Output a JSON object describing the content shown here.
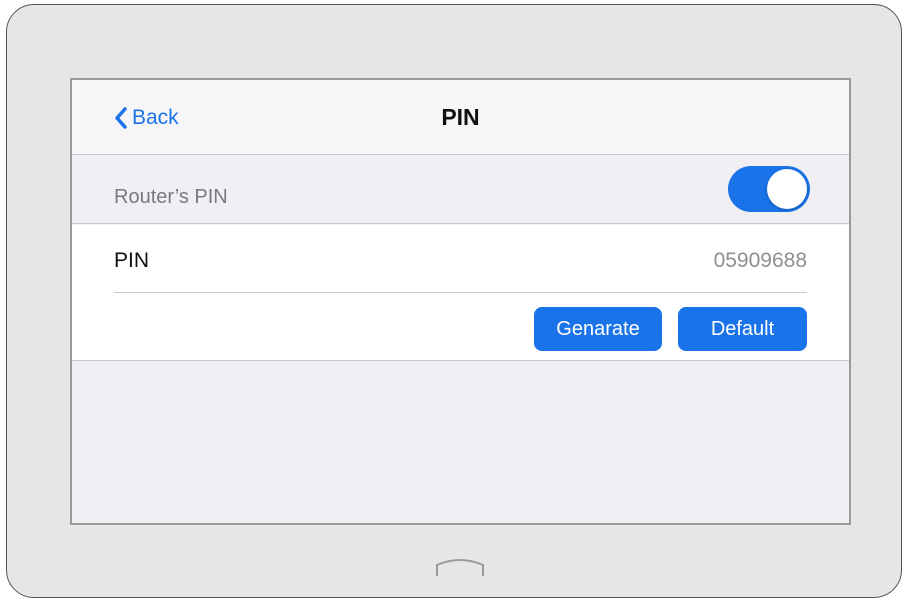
{
  "navbar": {
    "back_label": "Back",
    "title": "PIN"
  },
  "section": {
    "label": "Router’s PIN",
    "toggle_on": true
  },
  "pin_row": {
    "label": "PIN",
    "value": "05909688"
  },
  "actions": {
    "generate_label": "Genarate",
    "default_label": "Default"
  },
  "colors": {
    "accent": "#1a73e8",
    "device_frame": "#e6e6e6",
    "screen_bg": "#efeff4"
  },
  "icons": {
    "back": "chevron-left-icon",
    "home": "home-button-icon"
  }
}
